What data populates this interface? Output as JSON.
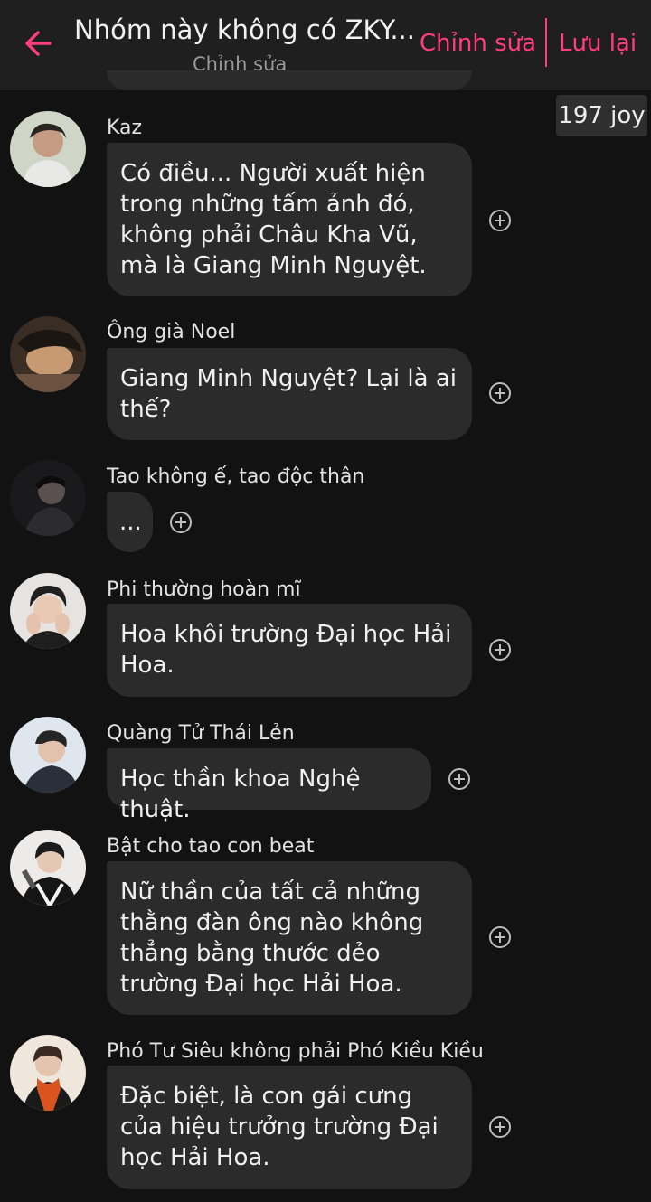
{
  "header": {
    "title": "Nhóm này không có ZKY...",
    "subtitle": "Chỉnh sửa",
    "edit_label": "Chỉnh sửa",
    "save_label": "Lưu lại",
    "back_icon": "arrow-left-icon"
  },
  "counter": {
    "joy": "197 joy"
  },
  "colors": {
    "accent": "#ff3d7f",
    "bubble": "#2b2b2b",
    "background": "#121212"
  },
  "messages": [
    {
      "name": "Kaz",
      "text": "Có điều... Người xuất hiện trong những tấm ảnh đó, không phải Châu Kha Vũ, mà là Giang Minh Nguyệt."
    },
    {
      "name": "Ông già Noel",
      "text": "Giang Minh Nguyệt? Lại là ai thế?"
    },
    {
      "name": "Tao không ế, tao độc thân",
      "text": "..."
    },
    {
      "name": "Phi thường hoàn mĩ",
      "text": "Hoa khôi trường Đại học Hải Hoa."
    },
    {
      "name": "Quàng Tử Thái Lẻn",
      "text": "Học thần khoa Nghệ thuật."
    },
    {
      "name": "Bật cho tao con beat",
      "text": "Nữ thần của tất cả những thằng đàn ông nào không thẳng bằng thước dẻo trường Đại học Hải Hoa."
    },
    {
      "name": "Phó Tư Siêu không phải Phó Kiều Kiều",
      "text": "Đặc biệt, là con gái cưng của hiệu trưởng trường Đại học Hải Hoa."
    }
  ]
}
